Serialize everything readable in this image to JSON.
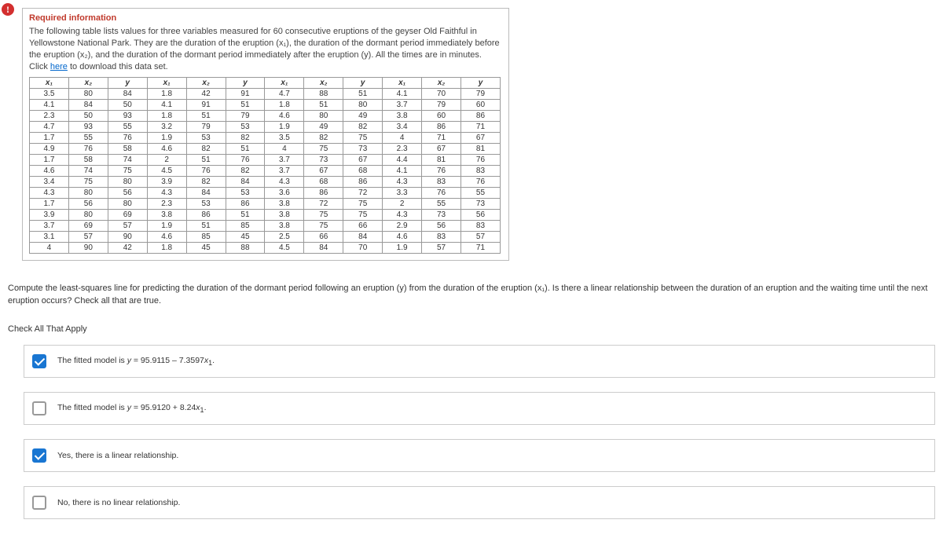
{
  "header": {
    "title": "Required information",
    "intro": "The following table lists values for three variables measured for 60 consecutive eruptions of the geyser Old Faithful in Yellowstone National Park. They are the duration of the eruption (x₁), the duration of the dormant period immediately before the eruption (x₂), and the duration of the dormant period immediately after the eruption (y). All the times are in minutes. Click ",
    "link": "here",
    "intro_tail": " to download this data set."
  },
  "table": {
    "headers": [
      "x₁",
      "x₂",
      "y",
      "x₁",
      "x₂",
      "y",
      "x₁",
      "x₂",
      "y",
      "x₁",
      "x₂",
      "y"
    ],
    "rows": [
      [
        "3.5",
        "80",
        "84",
        "1.8",
        "42",
        "91",
        "4.7",
        "88",
        "51",
        "4.1",
        "70",
        "79"
      ],
      [
        "4.1",
        "84",
        "50",
        "4.1",
        "91",
        "51",
        "1.8",
        "51",
        "80",
        "3.7",
        "79",
        "60"
      ],
      [
        "2.3",
        "50",
        "93",
        "1.8",
        "51",
        "79",
        "4.6",
        "80",
        "49",
        "3.8",
        "60",
        "86"
      ],
      [
        "4.7",
        "93",
        "55",
        "3.2",
        "79",
        "53",
        "1.9",
        "49",
        "82",
        "3.4",
        "86",
        "71"
      ],
      [
        "1.7",
        "55",
        "76",
        "1.9",
        "53",
        "82",
        "3.5",
        "82",
        "75",
        "4",
        "71",
        "67"
      ],
      [
        "4.9",
        "76",
        "58",
        "4.6",
        "82",
        "51",
        "4",
        "75",
        "73",
        "2.3",
        "67",
        "81"
      ],
      [
        "1.7",
        "58",
        "74",
        "2",
        "51",
        "76",
        "3.7",
        "73",
        "67",
        "4.4",
        "81",
        "76"
      ],
      [
        "4.6",
        "74",
        "75",
        "4.5",
        "76",
        "82",
        "3.7",
        "67",
        "68",
        "4.1",
        "76",
        "83"
      ],
      [
        "3.4",
        "75",
        "80",
        "3.9",
        "82",
        "84",
        "4.3",
        "68",
        "86",
        "4.3",
        "83",
        "76"
      ],
      [
        "4.3",
        "80",
        "56",
        "4.3",
        "84",
        "53",
        "3.6",
        "86",
        "72",
        "3.3",
        "76",
        "55"
      ],
      [
        "1.7",
        "56",
        "80",
        "2.3",
        "53",
        "86",
        "3.8",
        "72",
        "75",
        "2",
        "55",
        "73"
      ],
      [
        "3.9",
        "80",
        "69",
        "3.8",
        "86",
        "51",
        "3.8",
        "75",
        "75",
        "4.3",
        "73",
        "56"
      ],
      [
        "3.7",
        "69",
        "57",
        "1.9",
        "51",
        "85",
        "3.8",
        "75",
        "66",
        "2.9",
        "56",
        "83"
      ],
      [
        "3.1",
        "57",
        "90",
        "4.6",
        "85",
        "45",
        "2.5",
        "66",
        "84",
        "4.6",
        "83",
        "57"
      ],
      [
        "4",
        "90",
        "42",
        "1.8",
        "45",
        "88",
        "4.5",
        "84",
        "70",
        "1.9",
        "57",
        "71"
      ]
    ]
  },
  "question": "Compute the least-squares line for predicting the duration of the dormant period following an eruption (y) from the duration of the eruption (x₁). Is there a linear relationship between the duration of an eruption and the waiting time until the next eruption occurs? Check all that are true.",
  "checkLabel": "Check All That Apply",
  "options": [
    {
      "checked": true,
      "html": "The fitted model is <span class='ivar'>y</span> = 95.9115 – 7.3597<span class='ivar'>x</span><span class='sub1'>1</span>."
    },
    {
      "checked": false,
      "html": "The fitted model is <span class='ivar'>y</span> = 95.9120 + 8.24<span class='ivar'>x</span><span class='sub1'>1</span>."
    },
    {
      "checked": true,
      "html": "Yes, there is a linear relationship."
    },
    {
      "checked": false,
      "html": "No, there is no linear relationship."
    }
  ]
}
